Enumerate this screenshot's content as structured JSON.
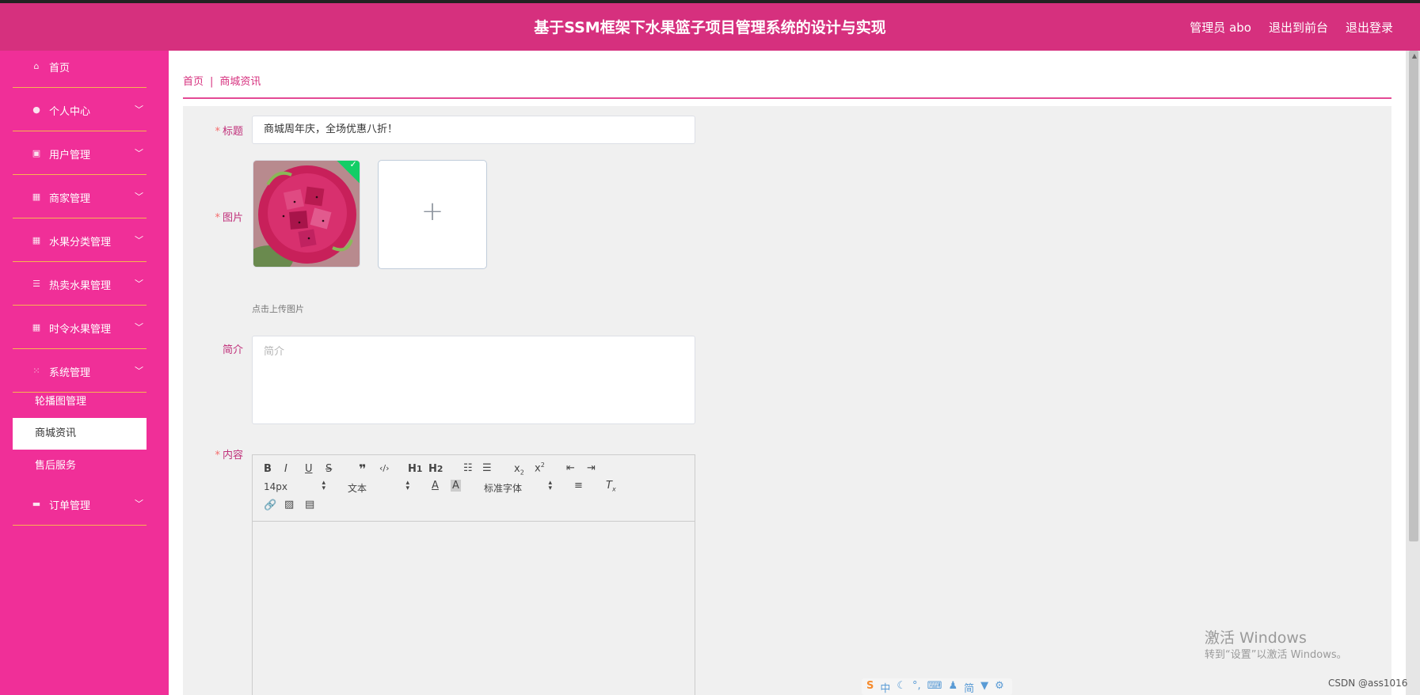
{
  "header": {
    "title": "基于SSM框架下水果篮子项目管理系统的设计与实现",
    "user": "管理员 abo",
    "to_front": "退出到前台",
    "logout": "退出登录"
  },
  "sidebar": {
    "items": [
      {
        "label": "首页",
        "icon": "home-icon"
      },
      {
        "label": "个人中心",
        "icon": "user-icon"
      },
      {
        "label": "用户管理",
        "icon": "clipboard-icon"
      },
      {
        "label": "商家管理",
        "icon": "grid-icon"
      },
      {
        "label": "水果分类管理",
        "icon": "grid-icon"
      },
      {
        "label": "热卖水果管理",
        "icon": "list-icon"
      },
      {
        "label": "时令水果管理",
        "icon": "grid-icon"
      },
      {
        "label": "系统管理",
        "icon": "apps-icon"
      },
      {
        "label": "订单管理",
        "icon": "monitor-icon"
      }
    ],
    "sub_items": [
      "轮播图管理",
      "商城资讯",
      "售后服务"
    ],
    "active_sub": "商城资讯"
  },
  "breadcrumb": {
    "home": "首页",
    "separator": "|",
    "current": "商城资讯"
  },
  "form": {
    "title_label": "标题",
    "title_value": "商城周年庆，全场优惠八折！",
    "image_label": "图片",
    "upload_tip": "点击上传图片",
    "intro_label": "简介",
    "intro_placeholder": "简介",
    "content_label": "内容",
    "required_mark": "*"
  },
  "editor": {
    "font_size": "14px",
    "block_type": "文本",
    "font_family": "标准字体"
  },
  "watermark": {
    "line1": "激活 Windows",
    "line2": "转到“设置”以激活 Windows。"
  },
  "credit": "CSDN @ass1016",
  "ime": {
    "logo": "S",
    "lang": "中",
    "simplified": "简"
  },
  "colors": {
    "header_bg": "#d6307e",
    "sidebar_bg": "#f02f98",
    "accent": "#c0307a",
    "success": "#13ce66"
  }
}
